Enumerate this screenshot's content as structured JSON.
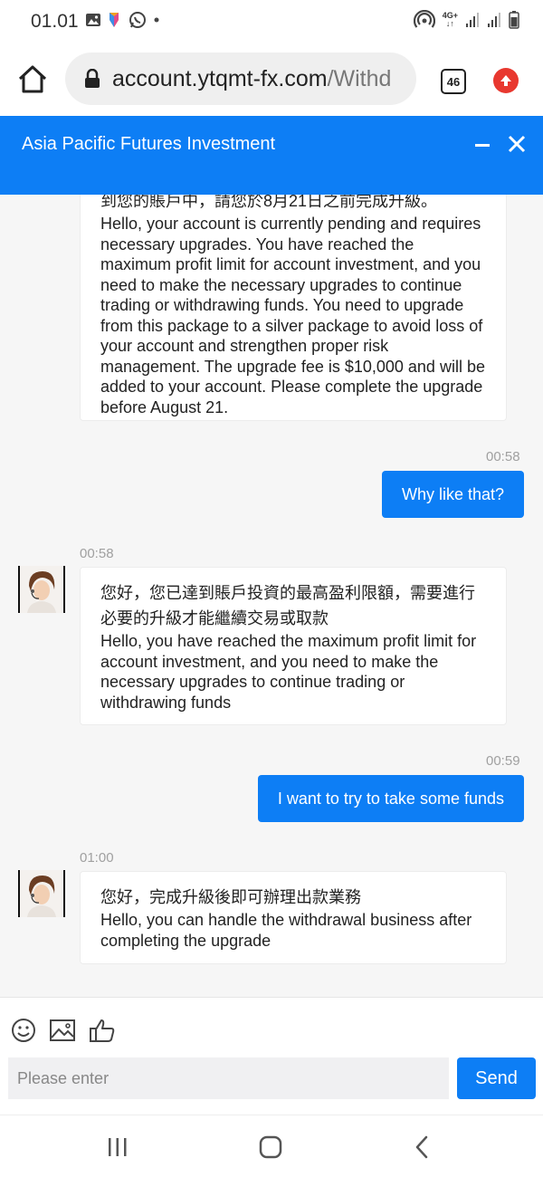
{
  "status_bar": {
    "time": "01.01",
    "network_label_top": "4G+",
    "network_label_bottom": "↓↑"
  },
  "browser": {
    "url_domain": "account.ytqmt-fx.com",
    "url_path": "/Withd",
    "tab_count": "46"
  },
  "chat_header": {
    "title": "Asia Pacific Futures Investment"
  },
  "messages": [
    {
      "type": "incoming",
      "zh": "到您的賬戶中，請您於8月21日之前完成升級。",
      "en": "Hello, your account is currently pending and requires necessary upgrades. You have reached the maximum profit limit for account investment, and you need to make the necessary upgrades to continue trading or withdrawing funds. You need to upgrade from this package to a silver package to avoid loss of your account and strengthen proper risk management. The upgrade fee is $10,000 and will be added to your account. Please complete the upgrade before August 21."
    },
    {
      "type": "outgoing",
      "time": "00:58",
      "text": "Why like that?"
    },
    {
      "type": "incoming",
      "time": "00:58",
      "zh": "您好，您已達到賬戶投資的最高盈利限額，需要進行必要的升級才能繼續交易或取款",
      "en": "Hello, you have reached the maximum profit limit for account investment, and you need to make the necessary upgrades to continue trading or withdrawing funds"
    },
    {
      "type": "outgoing",
      "time": "00:59",
      "text": "I want to try to take some funds"
    },
    {
      "type": "incoming",
      "time": "01:00",
      "zh": "您好，完成升級後即可辦理出款業務",
      "en": "Hello, you can handle the withdrawal business after completing the upgrade"
    }
  ],
  "composer": {
    "placeholder": "Please enter",
    "send_label": "Send"
  },
  "colors": {
    "accent": "#0d7ef5",
    "update_badge": "#e8382f"
  }
}
